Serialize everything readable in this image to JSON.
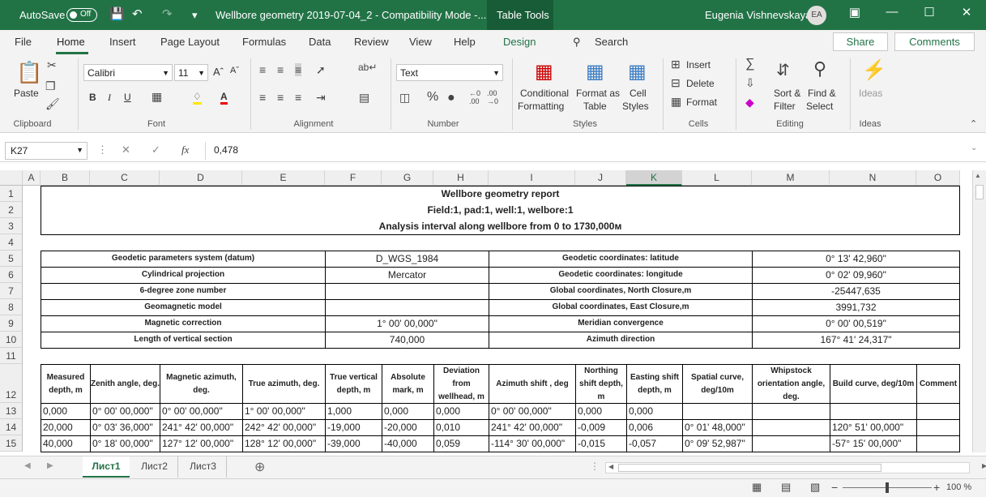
{
  "titlebar": {
    "autosave": "AutoSave",
    "toggle": "Off",
    "filename": "Wellbore geometry 2019-07-04_2  -  Compatibility Mode  -...",
    "table_tools": "Table Tools",
    "user": "Eugenia Vishnevskaya",
    "initials": "EA"
  },
  "tabs": [
    "File",
    "Home",
    "Insert",
    "Page Layout",
    "Formulas",
    "Data",
    "Review",
    "View",
    "Help",
    "Design"
  ],
  "search": "Search",
  "share": "Share",
  "comments": "Comments",
  "ribbon": {
    "clipboard": "Clipboard",
    "paste": "Paste",
    "font_group": "Font",
    "font_name": "Calibri",
    "font_size": "11",
    "alignment": "Alignment",
    "number": "Number",
    "number_format": "Text",
    "styles": "Styles",
    "cond1": "Conditional",
    "cond2": "Formatting",
    "fmt1": "Format as",
    "fmt2": "Table",
    "cell1": "Cell",
    "cell2": "Styles",
    "cells": "Cells",
    "insert": "Insert",
    "delete": "Delete",
    "format": "Format",
    "editing": "Editing",
    "sort1": "Sort &",
    "sort2": "Filter",
    "find1": "Find &",
    "find2": "Select",
    "ideas_group": "Ideas",
    "ideas": "Ideas"
  },
  "formula": {
    "namebox": "K27",
    "value": "0,478"
  },
  "columns": [
    "A",
    "B",
    "C",
    "D",
    "E",
    "F",
    "G",
    "H",
    "I",
    "J",
    "K",
    "L",
    "M",
    "N",
    "O"
  ],
  "rows": [
    "1",
    "2",
    "3",
    "4",
    "5",
    "6",
    "7",
    "8",
    "9",
    "10",
    "11",
    "12",
    "13",
    "14",
    "15"
  ],
  "report": {
    "title": "Wellbore geometry report",
    "field": "Field:1, pad:1, well:1, welbore:1",
    "interval": "Analysis interval along wellbore from 0 to    1730,000м"
  },
  "params": {
    "l5": "Geodetic parameters system (datum)",
    "v5": "D_WGS_1984",
    "r5": "Geodetic coordinates: latitude",
    "rv5": "0° 13' 42,960\"",
    "l6": "Cylindrical projection",
    "v6": "Mercator",
    "r6": "Geodetic coordinates: longitude",
    "rv6": "0° 02' 09,960\"",
    "l7": "6-degree zone number",
    "v7": "",
    "r7": "Global coordinates, North Closure,m",
    "rv7": "-25447,635",
    "l8": "Geomagnetic model",
    "v8": "",
    "r8": "Global coordinates, East Closure,m",
    "rv8": "3991,732",
    "l9": "Magnetic correction",
    "v9": "1° 00' 00,000\"",
    "r9": "Meridian convergence",
    "rv9": "0° 00' 00,519\"",
    "l10": "Length of vertical section",
    "v10": "740,000",
    "r10": "Azimuth direction",
    "rv10": "167° 41' 24,317\""
  },
  "table_headers": {
    "b": "Measured depth, m",
    "c": "Zenith angle, deg.",
    "d": "Magnetic azimuth, deg.",
    "e": "True azimuth, deg.",
    "f": "True vertical depth, m",
    "g": "Absolute mark, m",
    "h": "Deviation from wellhead, m",
    "i": "Azimuth shift , deg",
    "j": "Northing shift depth, m",
    "k": "Easting shift depth, m",
    "l": "Spatial curve, deg/10m",
    "m": "Whipstock orientation angle, deg.",
    "n": "Build curve, deg/10m",
    "o": "Comment"
  },
  "data_rows": [
    {
      "b": "0,000",
      "c": "0° 00' 00,000\"",
      "d": "0° 00' 00,000\"",
      "e": "1° 00' 00,000\"",
      "f": "1,000",
      "g": "0,000",
      "h": "0,000",
      "i": "0° 00' 00,000\"",
      "j": "0,000",
      "k": "0,000",
      "l": "",
      "m": "",
      "n": "",
      "o": ""
    },
    {
      "b": "20,000",
      "c": "0° 03' 36,000\"",
      "d": "241° 42' 00,000\"",
      "e": "242° 42' 00,000\"",
      "f": "-19,000",
      "g": "-20,000",
      "h": "0,010",
      "i": "241° 42' 00,000\"",
      "j": "-0,009",
      "k": "0,006",
      "l": "0° 01' 48,000\"",
      "m": "",
      "n": "120° 51' 00,000\"",
      "o": ""
    },
    {
      "b": "40,000",
      "c": "0° 18' 00,000\"",
      "d": "127° 12' 00,000\"",
      "e": "128° 12' 00,000\"",
      "f": "-39,000",
      "g": "-40,000",
      "h": "0,059",
      "i": "-114° 30' 00,000\"",
      "j": "-0,015",
      "k": "-0,057",
      "l": "0° 09' 52,987\"",
      "m": "",
      "n": "-57° 15' 00,000\"",
      "o": ""
    }
  ],
  "sheets": [
    "Лист1",
    "Лист2",
    "Лист3"
  ],
  "zoom": "100 %"
}
